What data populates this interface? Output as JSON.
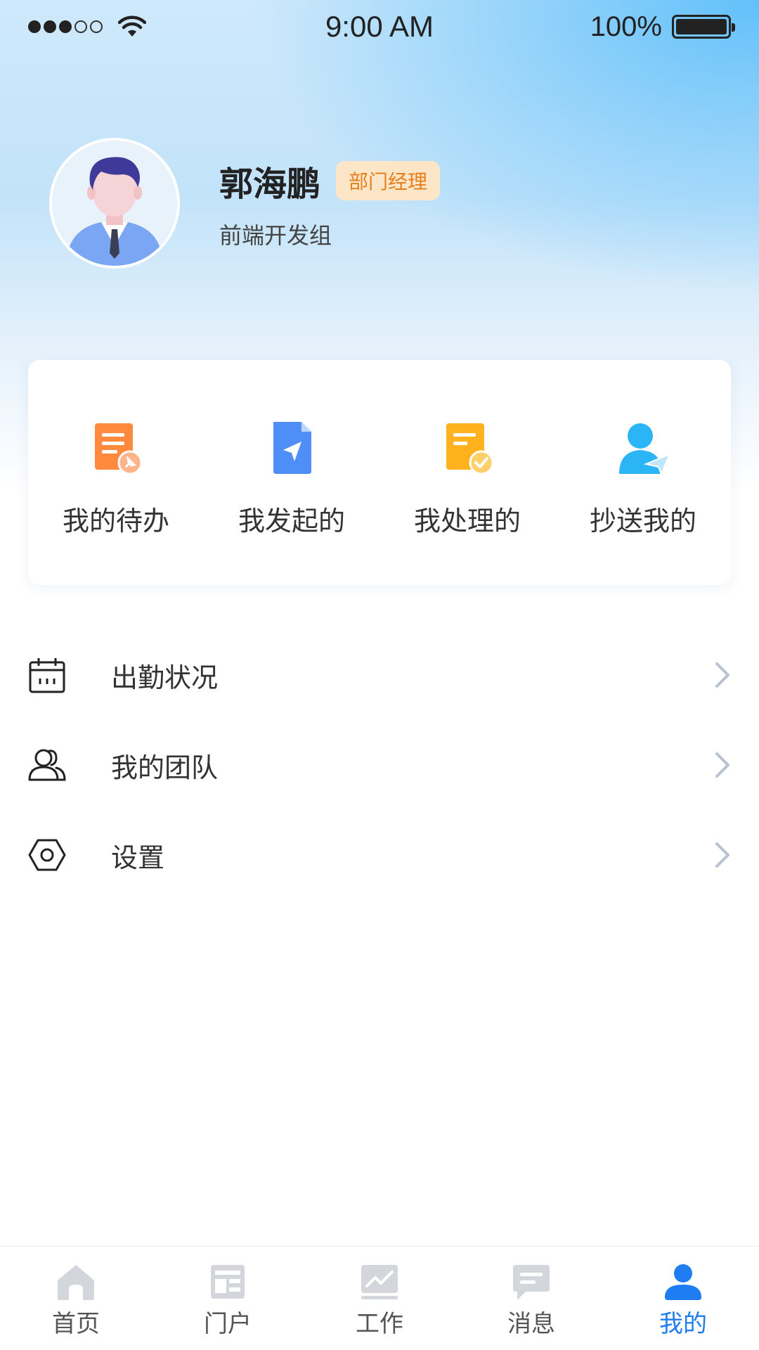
{
  "status_bar": {
    "time": "9:00 AM",
    "battery": "100%",
    "signal_dots_filled": 3,
    "signal_dots_total": 5
  },
  "profile": {
    "name": "郭海鹏",
    "role": "部门经理",
    "department": "前端开发组"
  },
  "quick_actions": [
    {
      "label": "我的待办",
      "icon": "todo-doc-icon",
      "color": "#ff8a3d"
    },
    {
      "label": "我发起的",
      "icon": "sent-doc-icon",
      "color": "#4f8ef7"
    },
    {
      "label": "我处理的",
      "icon": "handled-doc-icon",
      "color": "#ffb21e"
    },
    {
      "label": "抄送我的",
      "icon": "cc-user-icon",
      "color": "#2bb5f6"
    }
  ],
  "menu": [
    {
      "label": "出勤状况",
      "icon": "calendar-icon"
    },
    {
      "label": "我的团队",
      "icon": "team-icon"
    },
    {
      "label": "设置",
      "icon": "settings-hex-icon"
    }
  ],
  "tabs": [
    {
      "label": "首页",
      "icon": "home-icon",
      "active": false
    },
    {
      "label": "门户",
      "icon": "portal-icon",
      "active": false
    },
    {
      "label": "工作",
      "icon": "work-chart-icon",
      "active": false
    },
    {
      "label": "消息",
      "icon": "message-icon",
      "active": false
    },
    {
      "label": "我的",
      "icon": "profile-icon",
      "active": true
    }
  ],
  "colors": {
    "accent": "#1f7df1",
    "badge_bg": "#fde6c8",
    "badge_text": "#e67f1b",
    "tab_inactive_icon": "#d3d6db"
  }
}
